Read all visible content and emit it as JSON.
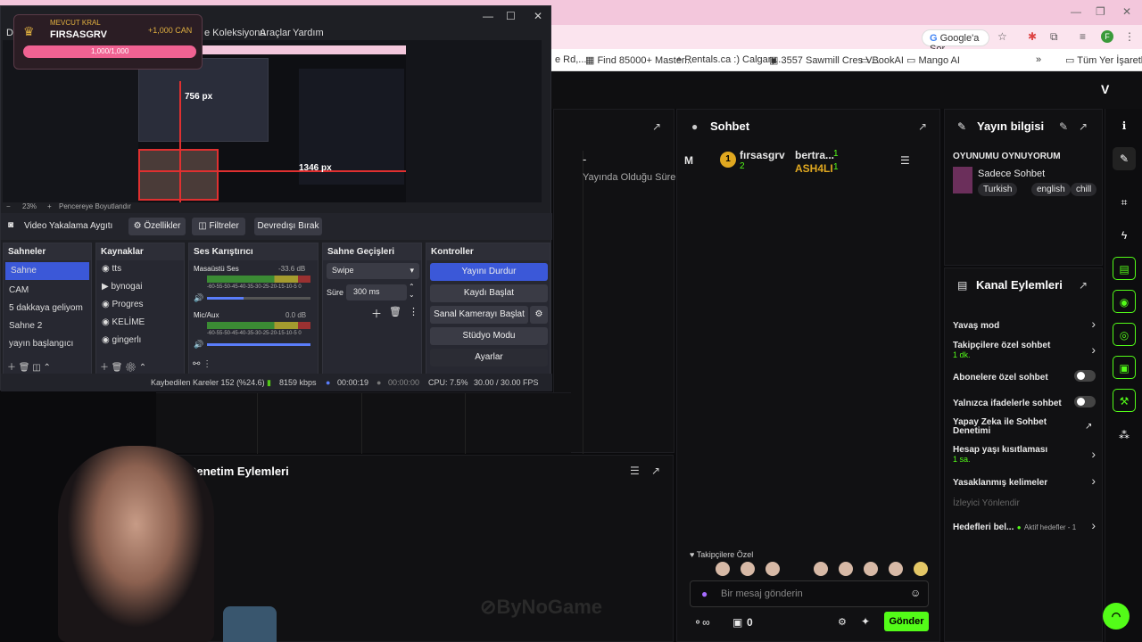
{
  "browser": {
    "google_btn": "Google'a Sor",
    "bookmarks": [
      "e Rd,...",
      "Find 85000+ Master...",
      "Rentals.ca :) Calgary...",
      "3557 Sawmill Cres V...",
      "BookAI",
      "Mango AI",
      "»",
      "Tüm Yer İşaretleri"
    ]
  },
  "kick": {
    "chat": {
      "title": "Sohbet",
      "user_initial": "M",
      "user1": "fırsasgrv",
      "user1_badge": "1",
      "user1_count": "2",
      "user2": "bertra...",
      "user2_count": "1",
      "user3": "ASH4LI",
      "user3_count": "1",
      "followers_label": "Takipçilere Özel",
      "input_placeholder": "Bir mesaj gönderin",
      "send": "Gönder",
      "count": "0",
      "inf": "∞"
    },
    "stream_info": {
      "title": "Yayın bilgisi",
      "stream_title": "OYUNUMU OYNUYORUM",
      "category": "Sadece Sohbet",
      "tags": [
        "Turkish",
        "english",
        "chill"
      ]
    },
    "channel_actions": {
      "title": "Kanal Eylemleri",
      "items": [
        {
          "label": "Yavaş mod",
          "sub": "",
          "type": "chev"
        },
        {
          "label": "Takipçilere özel sohbet",
          "sub": "1 dk.",
          "type": "chev"
        },
        {
          "label": "Abonelere özel sohbet",
          "sub": "",
          "type": "toggle"
        },
        {
          "label": "Yalnızca ifadelerle sohbet",
          "sub": "",
          "type": "toggle"
        },
        {
          "label": "Yapay Zeka ile Sohbet Denetimi",
          "sub": "",
          "type": "ext"
        },
        {
          "label": "Hesap yaşı kısıtlaması",
          "sub": "1 sa.",
          "type": "chev"
        },
        {
          "label": "Yasaklanmış kelimeler",
          "sub": "",
          "type": "chev"
        },
        {
          "label": "İzleyici Yönlendir",
          "sub": "",
          "type": "none"
        },
        {
          "label": "Hedefleri bel...",
          "sub": "Aktif hedefler - 1",
          "type": "chev"
        }
      ]
    },
    "mod_actions": {
      "title": "Denetim Eylemleri"
    },
    "stats": {
      "dash": "-",
      "duration": "Yayında Olduğu Süre"
    },
    "watermark": "ByNoGame"
  },
  "obs": {
    "menu": [
      "Do",
      "e Koleksiyonu",
      "Araçlar",
      "Yardım"
    ],
    "overlay": {
      "tag": "MEVCUT KRAL",
      "name": "FIRSASGRV",
      "amount": "+1,000 CAN",
      "bar_label": "1,000/1,000",
      "bar_fraction": 1
    },
    "preview_labels": {
      "w": "756 px",
      "h": "1346 px"
    },
    "zoom": "23%",
    "fit": "Pencereye Boyutlandır",
    "source_bar": {
      "name": "Video Yakalama Aygıtı",
      "props": "Özellikler",
      "filters": "Filtreler",
      "disable": "Devredışı Bırak"
    },
    "scenes": {
      "title": "Sahneler",
      "items": [
        "Sahne",
        "CAM",
        "5 dakkaya geliyom",
        "Sahne 2",
        "yayın başlangıcı"
      ]
    },
    "sources": {
      "title": "Kaynaklar",
      "items": [
        "tts",
        "bynogai",
        "Progres",
        "KELİME",
        "gingerlı"
      ]
    },
    "mixer": {
      "title": "Ses Karıştırıcı",
      "ch1": "Masaüstü Ses",
      "ch1_db": "-33.6 dB",
      "ch2": "Mic/Aux",
      "ch2_db": "0.0 dB",
      "ticks": "-60-55-50-45-40-35-30-25-20-15-10-5 0"
    },
    "transitions": {
      "title": "Sahne Geçişleri",
      "type": "Swipe",
      "dur_label": "Süre",
      "dur": "300 ms"
    },
    "controls": {
      "title": "Kontroller",
      "stop": "Yayını Durdur",
      "record": "Kaydı Başlat",
      "vcam": "Sanal Kamerayı Başlat",
      "studio": "Stüdyo Modu",
      "settings": "Ayarlar"
    },
    "status": {
      "dropped": "Kaybedilen Kareler 152 (%24.6)",
      "kbps": "8159 kbps",
      "live": "00:00:19",
      "rec": "00:00:00",
      "cpu": "CPU: 7.5%",
      "fps": "30.00 / 30.00 FPS"
    }
  }
}
